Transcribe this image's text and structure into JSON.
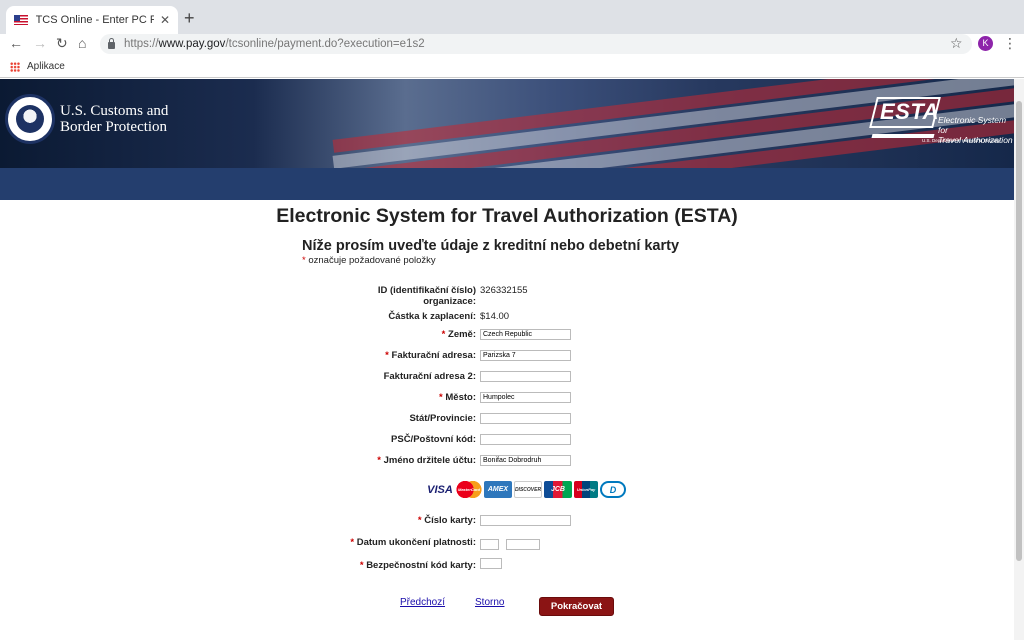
{
  "browser": {
    "tab_title": "TCS Online - Enter PC Payment",
    "tab_close": "✕",
    "new_tab": "+",
    "url_scheme": "https://",
    "url_host": "www.pay.gov",
    "url_path": "/tcsonline/payment.do?execution=e1s2",
    "bookmark_label": "Aplikace",
    "profile_initial": "K",
    "icons": [
      "back-arrow-icon",
      "forward-arrow-icon",
      "reload-icon",
      "home-icon",
      "lock-icon",
      "star-icon",
      "menu-dots-icon",
      "apps-grid-icon",
      "us-flag-icon"
    ]
  },
  "banner": {
    "agency_line1": "U.S. Customs and",
    "agency_line2": "Border Protection",
    "esta_word": "ESTA",
    "esta_sub1": "Electronic System for",
    "esta_sub2": "Travel Authorization",
    "esta_dhs": "U.S. Department of Homeland Security"
  },
  "page": {
    "title": "Electronic System for Travel Authorization (ESTA)",
    "subtitle": "Níže prosím uveďte údaje z kreditní nebo debetní karty",
    "required_mark": "*",
    "required_note": "označuje požadované položky"
  },
  "form": {
    "org_id_label_1": "ID (identifikační číslo)",
    "org_id_label_2": "organizace:",
    "org_id_value": "326332155",
    "amount_label": "Částka k zaplacení:",
    "amount_value": "$14.00",
    "country_label": "Země:",
    "country_value": "Czech Republic",
    "address_label": "Fakturační adresa:",
    "address_value": "Parizska 7",
    "address2_label": "Fakturační adresa 2:",
    "address2_value": "",
    "city_label": "Město:",
    "city_value": "Humpolec",
    "state_label": "Stát/Provincie:",
    "state_value": "",
    "zip_label": "PSČ/Poštovní kód:",
    "zip_value": "",
    "holder_label": "Jméno držitele účtu:",
    "holder_value": "Bonifac Dobrodruh",
    "card_number_label": "Číslo karty:",
    "card_number_value": "",
    "expiry_label": "Datum ukončení platnosti:",
    "expiry_month": "",
    "expiry_year": "",
    "cvv_label": "Bezpečnostní kód karty:",
    "cvv_value": ""
  },
  "card_logos": {
    "visa": "VISA",
    "mastercard": "MasterCard",
    "amex": "AMEX",
    "discover": "DISCOVER",
    "jcb": "JCB",
    "unionpay": "UnionPay",
    "diners": "D"
  },
  "actions": {
    "previous": "Předchozí",
    "cancel": "Storno",
    "continue": "Pokračovat"
  },
  "colors": {
    "submit_bg": "#8b1414",
    "blue_bar": "#243e6e",
    "required": "#cc0000",
    "link": "#1a0dab"
  }
}
